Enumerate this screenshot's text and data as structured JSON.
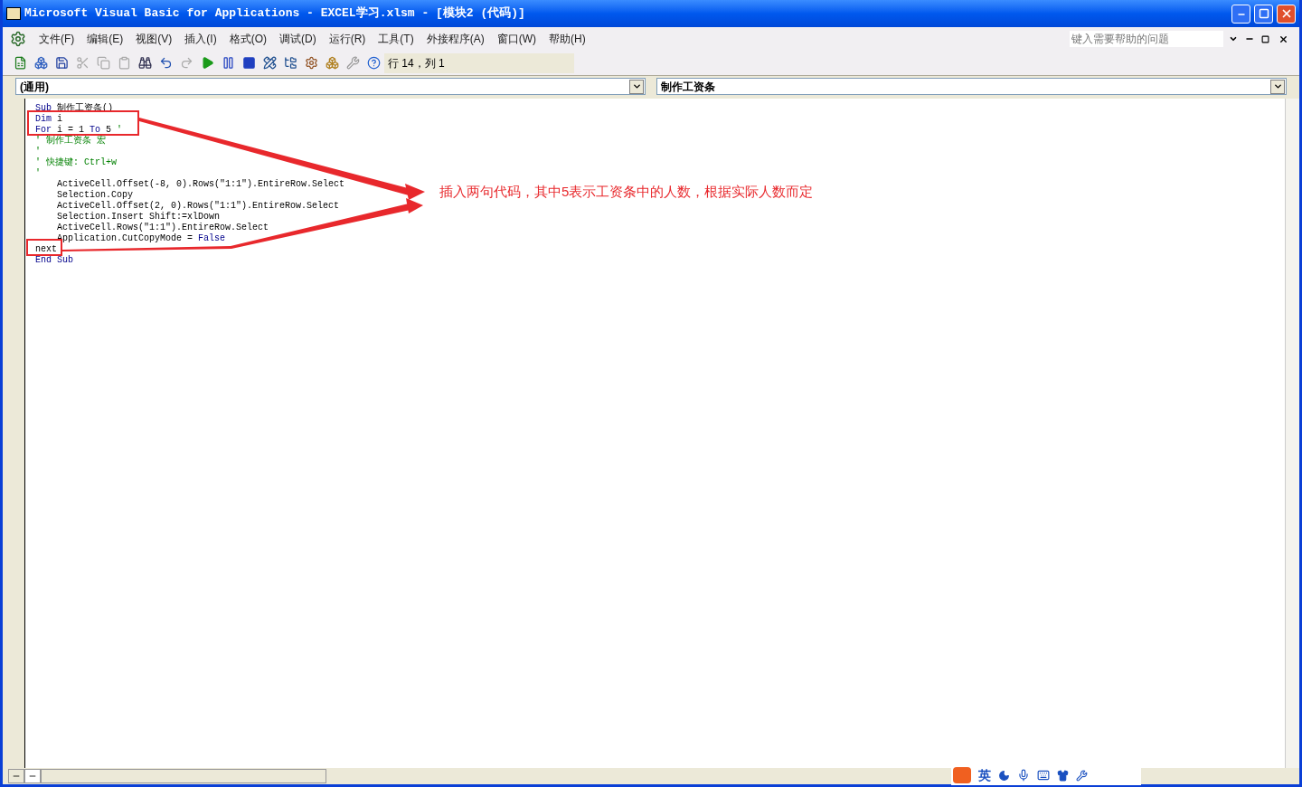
{
  "window": {
    "title": "Microsoft Visual Basic for Applications - EXCEL学习.xlsm - [模块2 (代码)]"
  },
  "menu": [
    "文件(F)",
    "编辑(E)",
    "视图(V)",
    "插入(I)",
    "格式(O)",
    "调试(D)",
    "运行(R)",
    "工具(T)",
    "外接程序(A)",
    "窗口(W)",
    "帮助(H)"
  ],
  "help_search": {
    "placeholder": "键入需要帮助的问题"
  },
  "toolbar": {
    "position": "行 14，列 1"
  },
  "object_combo": {
    "value": "(通用)"
  },
  "procedure_combo": {
    "value": "制作工资条"
  },
  "code": [
    {
      "parts": [
        {
          "text": "Sub",
          "kind": "keyword"
        },
        {
          "text": " 制作工资条()",
          "kind": "plain"
        }
      ]
    },
    {
      "parts": [
        {
          "text": "Dim",
          "kind": "keyword"
        },
        {
          "text": " i",
          "kind": "plain"
        }
      ]
    },
    {
      "parts": [
        {
          "text": "For",
          "kind": "keyword"
        },
        {
          "text": " i = 1 ",
          "kind": "plain"
        },
        {
          "text": "To",
          "kind": "keyword"
        },
        {
          "text": " 5 ",
          "kind": "plain"
        },
        {
          "text": "'",
          "kind": "comment"
        }
      ]
    },
    {
      "parts": [
        {
          "text": "' 制作工资条 宏",
          "kind": "comment"
        }
      ]
    },
    {
      "parts": [
        {
          "text": "'",
          "kind": "comment"
        }
      ]
    },
    {
      "parts": [
        {
          "text": "' 快捷键: Ctrl+w",
          "kind": "comment"
        }
      ]
    },
    {
      "parts": [
        {
          "text": "'",
          "kind": "comment"
        }
      ]
    },
    {
      "parts": [
        {
          "text": "    ActiveCell.Offset(-8, 0).Rows(\"1:1\").EntireRow.Select",
          "kind": "plain"
        }
      ]
    },
    {
      "parts": [
        {
          "text": "    Selection.Copy",
          "kind": "plain"
        }
      ]
    },
    {
      "parts": [
        {
          "text": "    ActiveCell.Offset(2, 0).Rows(\"1:1\").EntireRow.Select",
          "kind": "plain"
        }
      ]
    },
    {
      "parts": [
        {
          "text": "    Selection.Insert Shift:=xlDown",
          "kind": "plain"
        }
      ]
    },
    {
      "parts": [
        {
          "text": "    ActiveCell.Rows(\"1:1\").EntireRow.Select",
          "kind": "plain"
        }
      ]
    },
    {
      "parts": [
        {
          "text": "    Application.CutCopyMode = ",
          "kind": "plain"
        },
        {
          "text": "False",
          "kind": "keyword"
        }
      ]
    },
    {
      "parts": [
        {
          "text": "next",
          "kind": "plain"
        }
      ]
    },
    {
      "parts": [
        {
          "text": "End Sub",
          "kind": "keyword"
        }
      ]
    }
  ],
  "annotation": {
    "text": "插入两句代码，其中5表示工资条中的人数，根据实际人数而定"
  },
  "ime_bar": {
    "mode": "英"
  }
}
